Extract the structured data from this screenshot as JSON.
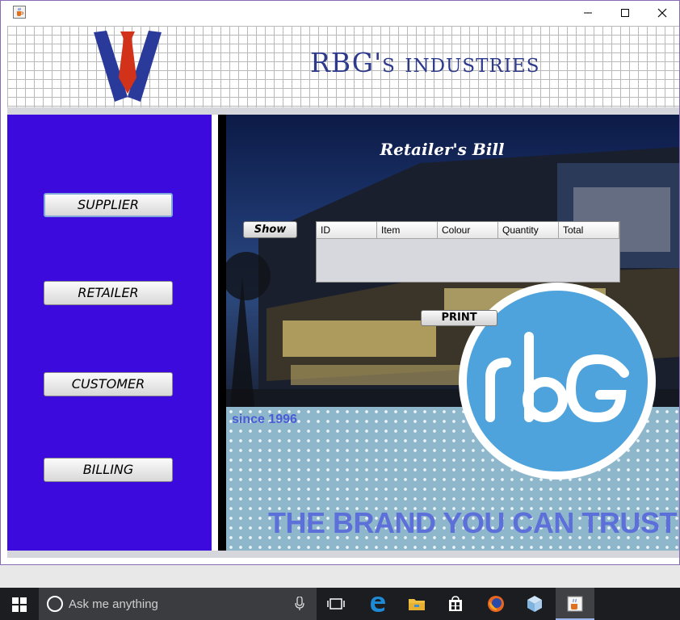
{
  "window": {
    "icon": "java-cup-icon",
    "controls": [
      "minimize-icon",
      "maximize-icon",
      "close-icon"
    ]
  },
  "header": {
    "company_name": "RBG's industries",
    "logo": "tie-logo"
  },
  "sidebar": {
    "buttons": [
      {
        "label": "SUPPLIER"
      },
      {
        "label": "RETAILER"
      },
      {
        "label": "CUSTOMER"
      },
      {
        "label": "BILLING"
      }
    ]
  },
  "main": {
    "heading": "Retailer's Bill",
    "show_button": "Show",
    "table": {
      "columns": [
        "ID",
        "Item",
        "Colour",
        "Quantity",
        "Total"
      ],
      "rows": []
    },
    "print_button": "PRINT",
    "since_label": "since 1996",
    "tagline": "THE BRAND YOU CAN TRUST",
    "brand_mark": "rbG"
  },
  "taskbar": {
    "search_placeholder": "Ask me anything",
    "pinned": [
      "task-view-icon",
      "edge-icon",
      "file-explorer-icon",
      "store-icon",
      "firefox-icon",
      "box3d-icon",
      "java-icon"
    ]
  },
  "colors": {
    "sidebar": "#3c0adc",
    "title_text": "#2d3a8c",
    "tagline": "#5d6fd8",
    "circle": "#4fa3dc"
  }
}
